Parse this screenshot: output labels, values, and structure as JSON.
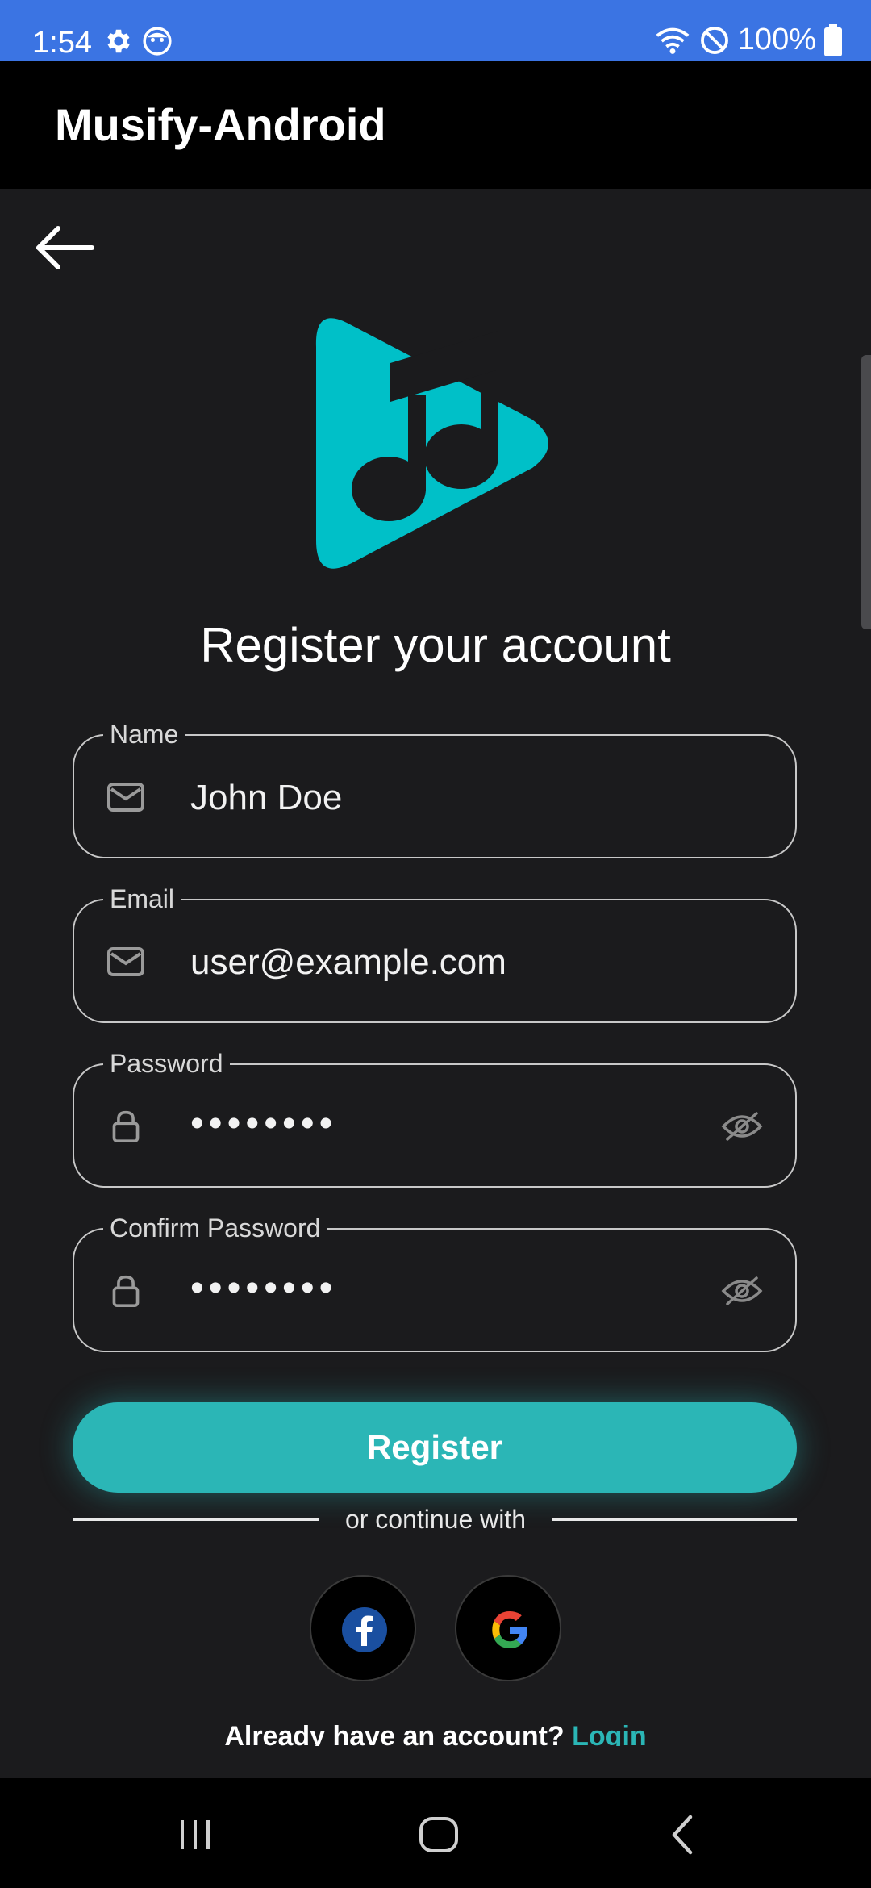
{
  "status_bar": {
    "time": "1:54",
    "battery": "100%",
    "icons": [
      "settings-icon",
      "face-icon",
      "wifi-icon",
      "do-not-disturb-icon",
      "battery-icon"
    ]
  },
  "app_bar": {
    "title": "Musify-Android"
  },
  "heading": "Register your account",
  "form": {
    "name": {
      "label": "Name",
      "value": "John Doe",
      "icon": "mail-icon"
    },
    "email": {
      "label": "Email",
      "value": "user@example.com",
      "icon": "mail-icon"
    },
    "password": {
      "label": "Password",
      "value": "••••••••",
      "icon": "lock-icon"
    },
    "confirm_password": {
      "label": "Confirm Password",
      "value": "••••••••",
      "icon": "lock-icon"
    }
  },
  "register_button": "Register",
  "divider_text": "or continue with",
  "social": [
    "facebook",
    "google"
  ],
  "login_prompt": {
    "text": "Already have an account? ",
    "link": "Login"
  },
  "colors": {
    "accent": "#2bb6b6",
    "status_bar": "#3b74e3",
    "background": "#1b1b1d"
  }
}
